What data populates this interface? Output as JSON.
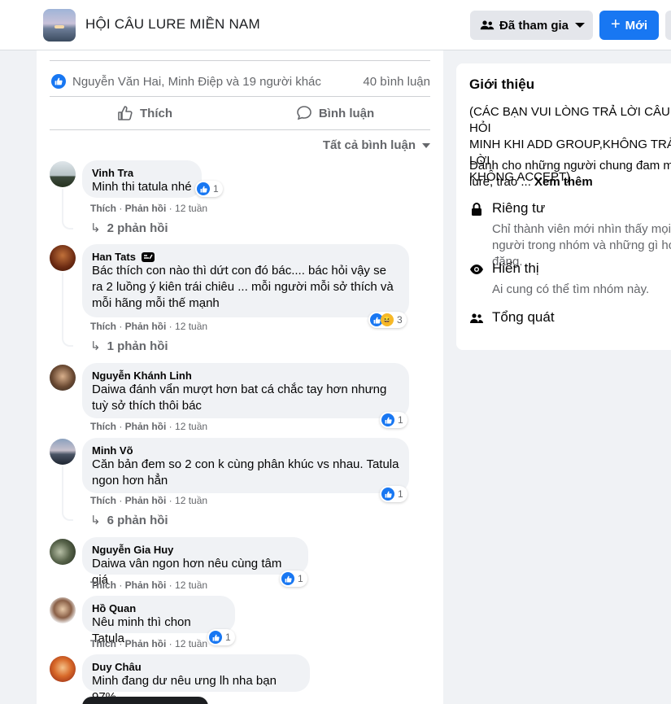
{
  "header": {
    "group_name": "HỘI CÂU LURE MIỀN NAM",
    "joined_label": "Đã tham gia",
    "new_label": "Mới"
  },
  "post": {
    "reaction_summary": "Nguyễn Văn Hai, Minh Điệp và 19 người khác",
    "comment_count": "40 bình luận",
    "like_label": "Thích",
    "comment_label": "Bình luận",
    "filter_label": "Tất cả bình luận"
  },
  "comments": [
    {
      "author": "Vinh Tra",
      "text": "Minh thi tatula nhé",
      "like": "Thích",
      "reply": "Phản hồi",
      "time": "12 tuần",
      "reactions": "1",
      "replies": "2 phản hồi"
    },
    {
      "author": "Han Tats",
      "text": "Bác thích con nào thì dứt con đó bác.... bác hỏi vậy se ra 2 luồng ý kiên trái chiêu ... mỗi người mỗi sở thích và mỗi hãng mỗi thế mạnh",
      "like": "Thích",
      "reply": "Phản hồi",
      "time": "12 tuần",
      "reactions": "3",
      "replies": "1 phản hồi"
    },
    {
      "author": "Nguyễn Khánh Linh",
      "text": "Daiwa đánh vẩn mượt hơn bat cá chắc tay hơn nhưng tuỳ sở thích thôi bác",
      "like": "Thích",
      "reply": "Phản hồi",
      "time": "12 tuần",
      "reactions": "1"
    },
    {
      "author": "Minh Võ",
      "text": "Căn bản đem so 2 con k cùng phân khúc vs nhau. Tatula ngon hơn hẳn",
      "like": "Thích",
      "reply": "Phản hồi",
      "time": "12 tuần",
      "reactions": "1",
      "replies": "6 phản hồi"
    },
    {
      "author": "Nguyễn Gia Huy",
      "text": "Daiwa vân ngon hơn nêu cùng tâm giá",
      "like": "Thích",
      "reply": "Phản hồi",
      "time": "12 tuần",
      "reactions": "1"
    },
    {
      "author": "Hồ Quan",
      "text": "Nêu minh thì chon Tatula",
      "like": "Thích",
      "reply": "Phản hồi",
      "time": "12 tuần",
      "reactions": "1"
    },
    {
      "author": "Duy Châu",
      "text": "Minh đang dư nêu ưng lh nha bạn 97%"
    }
  ],
  "about": {
    "title": "Giới thiệu",
    "description": "(CÁC BẠN VUI LÒNG TRẢ LỜI CÂU HỎI\nMINH KHI ADD GROUP,KHÔNG TRẢ LỜI\nKHÔNG ACCEPT)",
    "sub": "Dành cho những người chung đam mê lure, trao ...",
    "see_more": "Xem thêm",
    "private_title": "Riêng tư",
    "private_desc": "Chỉ thành viên mới nhìn thấy mọi người trong nhóm và những gì họ đăng.",
    "visible_title": "Hiển thị",
    "visible_desc": "Ai cung có thể tìm nhóm này.",
    "general_title": "Tổng quát"
  },
  "colors": {
    "accent": "#1877f2",
    "bubble": "#f0f2f5",
    "secondary_text": "#65676b"
  }
}
